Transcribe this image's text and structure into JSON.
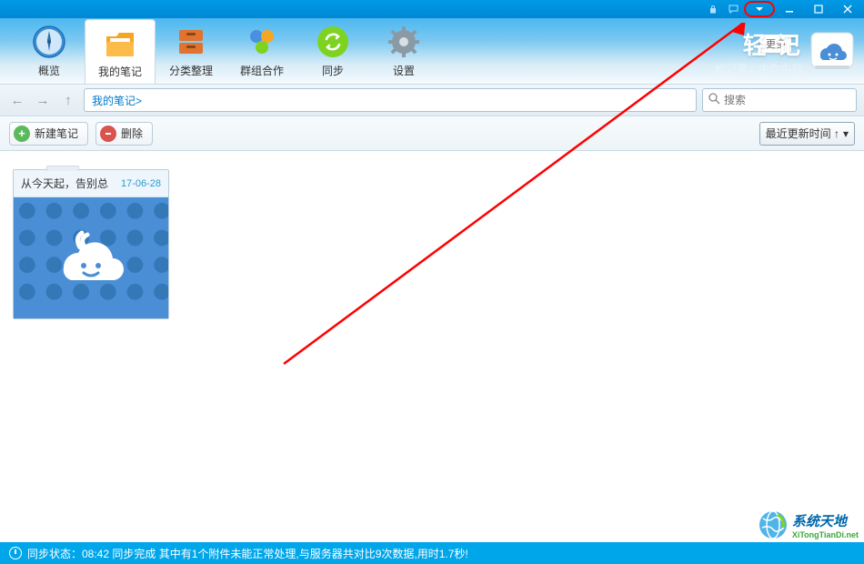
{
  "titlebar": {
    "icons": [
      "lock",
      "comment",
      "dropdown"
    ],
    "controls": [
      "minimize",
      "maximize",
      "close"
    ]
  },
  "toolbar": {
    "items": [
      {
        "id": "overview",
        "label": "概览"
      },
      {
        "id": "my-notes",
        "label": "我的笔记",
        "active": true
      },
      {
        "id": "category",
        "label": "分类整理"
      },
      {
        "id": "group",
        "label": "群组合作"
      },
      {
        "id": "sync",
        "label": "同步"
      },
      {
        "id": "settings",
        "label": "设置"
      }
    ]
  },
  "brand": {
    "title_partial": "轻   记",
    "subtitle": "松记录，由你由我",
    "more_label": "更多"
  },
  "nav": {
    "breadcrumb": "我的笔记>",
    "search_placeholder": "搜索"
  },
  "actions": {
    "new_note": "新建笔记",
    "delete": "删除",
    "sort_label": "最近更新时间 ↑"
  },
  "notes": [
    {
      "title": "从今天起，告别总",
      "date": "17-06-28"
    }
  ],
  "status": {
    "text": "同步状态：08:42 同步完成 其中有1个附件未能正常处理,与服务器共对比9次数据,用时1.7秒!"
  },
  "watermark": {
    "cn": "系统天地",
    "en": "XiTongTianDi.net"
  }
}
